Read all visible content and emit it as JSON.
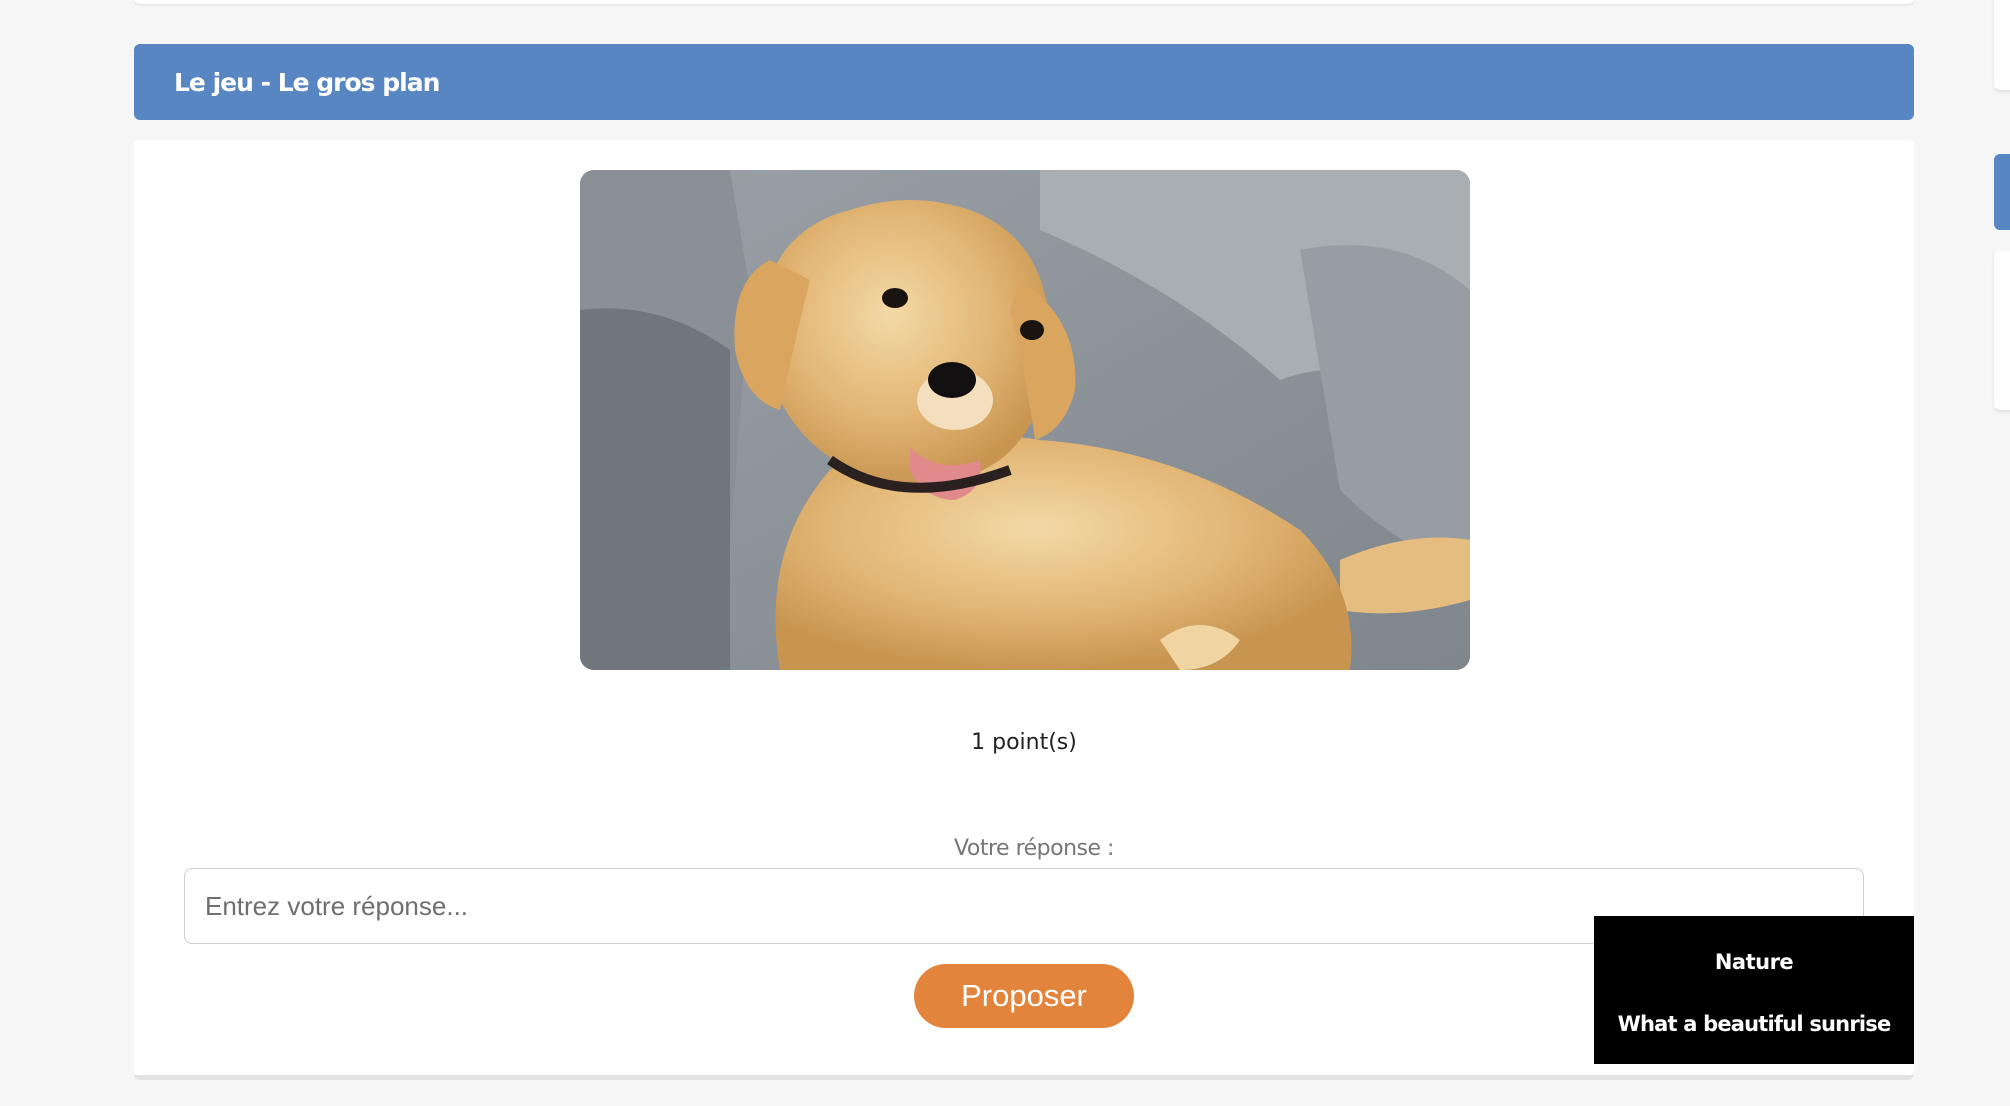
{
  "header": {
    "title": "Le jeu - Le gros plan"
  },
  "game": {
    "image": {
      "subject": "golden-retriever-puppy-on-grey-couch"
    },
    "points_text": "1 point(s)",
    "answer_label": "Votre réponse :",
    "answer_input": {
      "placeholder": "Entrez votre réponse...",
      "value": ""
    },
    "submit_label": "Proposer"
  },
  "toast": {
    "title": "Nature",
    "message": "What a beautiful sunrise"
  },
  "colors": {
    "header_bg": "#5886c2",
    "submit_bg": "#e2843b",
    "page_bg": "#f6f6f6",
    "toast_bg": "#000000"
  }
}
